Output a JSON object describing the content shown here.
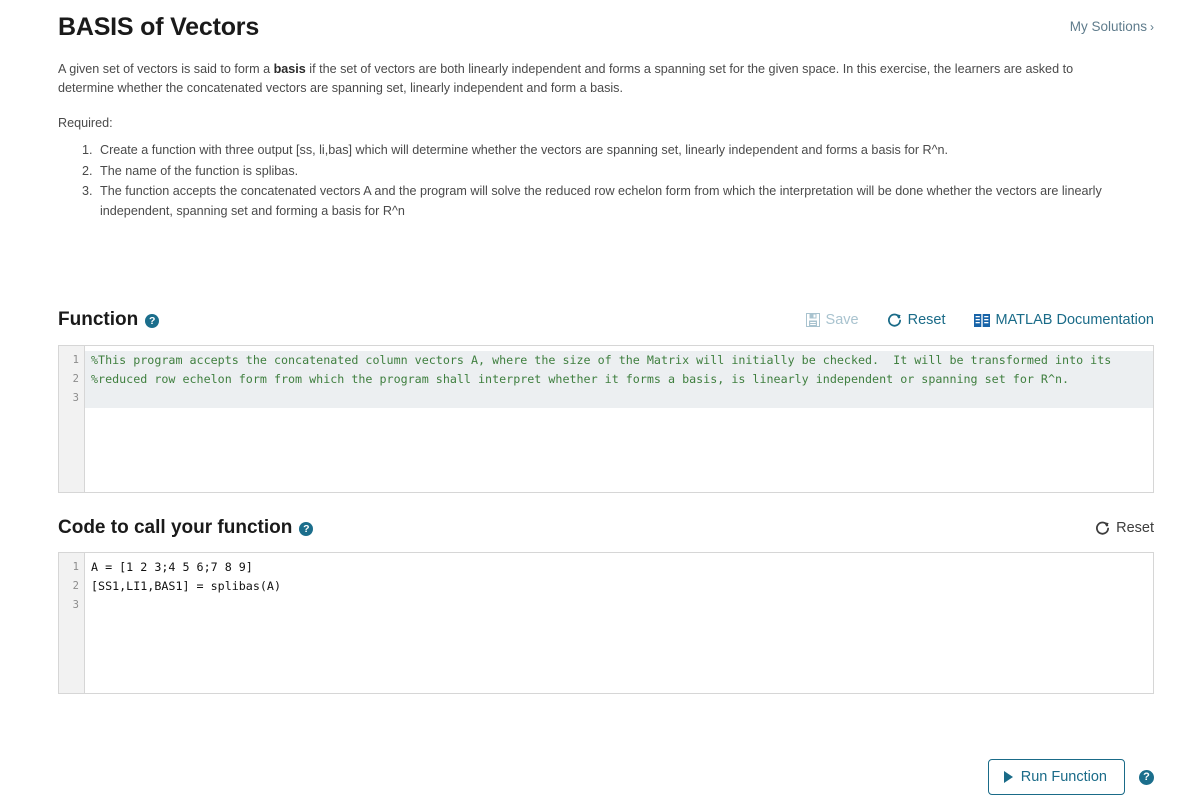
{
  "header": {
    "title": "BASIS of Vectors",
    "my_solutions": "My Solutions",
    "my_solutions_chevron": "›"
  },
  "description": {
    "intro_before_bold": "A given set of vectors is said to form a ",
    "intro_bold": "basis",
    "intro_after_bold": " if the set of vectors are both linearly independent and forms a spanning set for the given space.  In this exercise, the learners are asked to determine whether the concatenated vectors are spanning set, linearly independent and form a basis.",
    "required_label": "Required:",
    "requirements": [
      "Create a function with three output [ss, li,bas] which will determine whether the vectors are spanning set, linearly independent and forms a basis for R^n.",
      "The name of the function is splibas.",
      "The function accepts the concatenated vectors A and the program will solve the reduced row echelon form from which the interpretation will be done whether the vectors are linearly independent, spanning set and forming a basis for R^n"
    ]
  },
  "function_section": {
    "title": "Function",
    "help_glyph": "?",
    "toolbar": {
      "save_label": "Save",
      "reset_label": "Reset",
      "documentation_label": "MATLAB Documentation"
    },
    "editor": {
      "line_numbers": [
        "1",
        "2",
        "3"
      ],
      "lines": [
        "%This program accepts the concatenated column vectors A, where the size of the Matrix will initially be checked.  It will be transformed into its",
        "%reduced row echelon form from which the program shall interpret whether it forms a basis, is linearly independent or spanning set for R^n.",
        ""
      ]
    }
  },
  "call_section": {
    "title": "Code to call your function",
    "help_glyph": "?",
    "toolbar": {
      "reset_label": "Reset"
    },
    "editor": {
      "line_numbers": [
        "1",
        "2",
        "3"
      ],
      "lines": [
        "A = [1 2 3;4 5 6;7 8 9]",
        "[SS1,LI1,BAS1] = splibas(A)",
        ""
      ]
    }
  },
  "footer": {
    "run_label": "Run Function",
    "help_glyph": "?"
  },
  "colors": {
    "accent": "#1a6b88",
    "help_badge": "#1b6e8c",
    "link_muted": "#5f7c8c",
    "disabled": "#a9c3cf",
    "comment_green": "#3f7f3f",
    "line_highlight": "#eceff1",
    "gutter_bg": "#f2f2f2",
    "editor_border": "#d6d6d6"
  }
}
